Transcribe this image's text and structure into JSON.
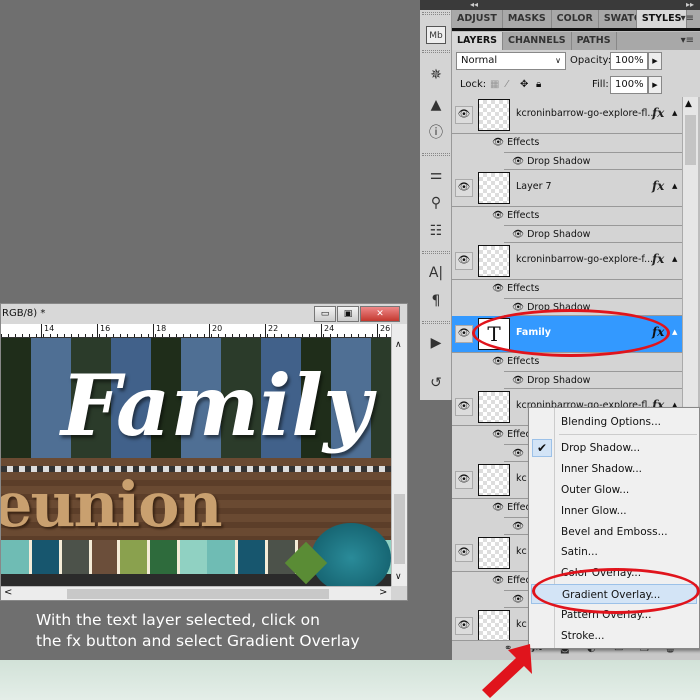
{
  "dock": {
    "collapse_left": "◂◂",
    "collapse_right": "▸▸"
  },
  "top_tabs": [
    {
      "label": "ADJUST"
    },
    {
      "label": "MASKS"
    },
    {
      "label": "COLOR"
    },
    {
      "label": "SWATCH"
    },
    {
      "label": "STYLES",
      "active": true
    }
  ],
  "layer_tabs": [
    {
      "label": "LAYERS",
      "active": true
    },
    {
      "label": "CHANNELS"
    },
    {
      "label": "PATHS"
    }
  ],
  "blend_mode": "Normal",
  "opacity_label": "Opacity:",
  "opacity": "100%",
  "lock_label": "Lock:",
  "fill_label": "Fill:",
  "fill": "100%",
  "layers": [
    {
      "name": "kcroninbarrow-go-explore-fl...",
      "effects_label": "Effects",
      "effect": "Drop Shadow"
    },
    {
      "name": "Layer 7",
      "effects_label": "Effects",
      "effect": "Drop Shadow"
    },
    {
      "name": "kcroninbarrow-go-explore-f...",
      "effects_label": "Effects",
      "effect": "Drop Shadow"
    },
    {
      "name": "Family",
      "selected": true,
      "type": "text",
      "thumb_glyph": "T",
      "effects_label": "Effects",
      "effect": "Drop Shadow"
    },
    {
      "name": "kcroninbarrow-go-explore-fl...",
      "effects_label": "Effects",
      "effect": "Drop Shadow"
    },
    {
      "name": "kc",
      "effects_label": "Effects",
      "effect": "Drop Shadow"
    },
    {
      "name": "kc",
      "effects_label": "Effects",
      "effect": "Drop Shadow"
    },
    {
      "name": "kc"
    }
  ],
  "fx_label": "fx",
  "document": {
    "title": "RGB/8) *",
    "ruler_ticks": [
      "14",
      "16",
      "18",
      "20",
      "22",
      "24",
      "26"
    ],
    "artwork_text_1": "Family",
    "artwork_text_2": "eunion"
  },
  "caption": [
    "With the text layer selected, click on",
    "the fx button and select Gradient Overlay"
  ],
  "context_menu": {
    "items": [
      {
        "label": "Blending Options..."
      },
      {
        "label": "Drop Shadow...",
        "checked": true
      },
      {
        "label": "Inner Shadow..."
      },
      {
        "label": "Outer Glow..."
      },
      {
        "label": "Inner Glow..."
      },
      {
        "label": "Bevel and Emboss..."
      },
      {
        "label": "Satin..."
      },
      {
        "label": "Color Overlay..."
      },
      {
        "label": "Gradient Overlay...",
        "highlighted": true
      },
      {
        "label": "Pattern Overlay..."
      },
      {
        "label": "Stroke..."
      }
    ]
  },
  "colors": {
    "selection": "#3399ff",
    "annotation": "#e0141c",
    "menu_highlight": "#d3e4f6"
  }
}
